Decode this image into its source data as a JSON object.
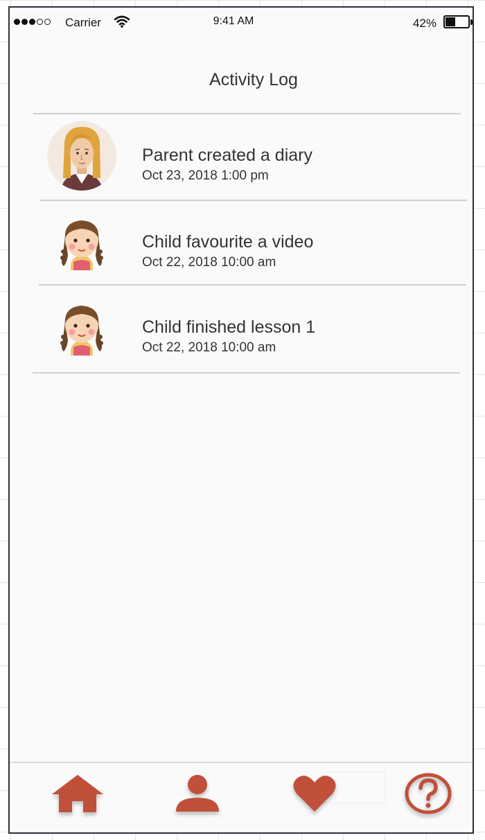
{
  "status_bar": {
    "carrier": "Carrier",
    "time": "9:41 AM",
    "battery_percent": "42%",
    "battery_level": 0.42
  },
  "header": {
    "title": "Activity Log"
  },
  "activities": [
    {
      "avatar": "parent-avatar",
      "title": "Parent created a diary",
      "date": "Oct 23, 2018 1:00 pm"
    },
    {
      "avatar": "child-avatar",
      "title": "Child favourite a video",
      "date": "Oct 22, 2018 10:00 am"
    },
    {
      "avatar": "child-avatar",
      "title": "Child finished lesson 1",
      "date": "Oct 22, 2018 10:00 am"
    }
  ],
  "tab_bar": {
    "accent": "#c0503a",
    "tabs": [
      {
        "icon": "home-icon"
      },
      {
        "icon": "profile-icon"
      },
      {
        "icon": "heart-icon"
      },
      {
        "icon": "help-icon"
      }
    ]
  }
}
